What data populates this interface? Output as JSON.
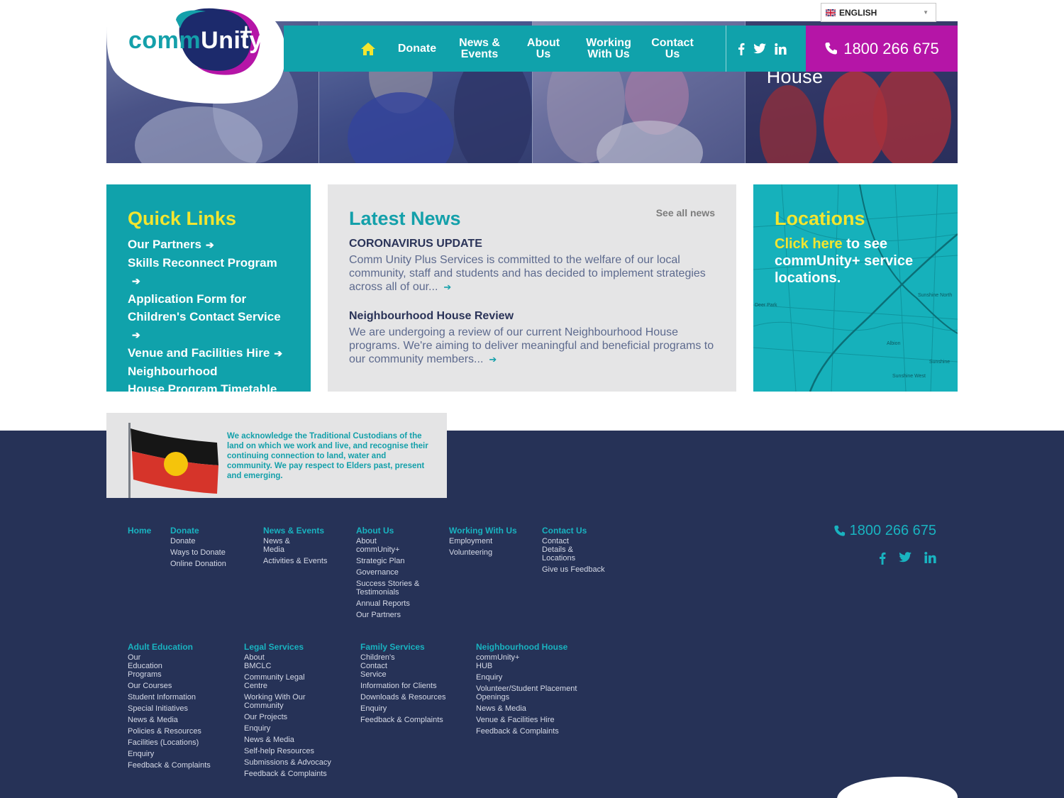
{
  "hero": {
    "caption": "House"
  },
  "logo": {
    "part1": "comm",
    "part2": "Unity",
    "plus": "+"
  },
  "language": {
    "selected": "ENGLISH"
  },
  "nav": {
    "home_icon": "home-icon",
    "donate": "Donate",
    "news_line1": "News &",
    "news_line2": "Events",
    "about_line1": "About",
    "about_line2": "Us",
    "work_line1": "Working",
    "work_line2": "With Us",
    "contact_line1": "Contact",
    "contact_line2": "Us",
    "social": [
      "facebook-icon",
      "twitter-icon",
      "linkedin-icon"
    ],
    "phone": "1800 266 675"
  },
  "quick_links": {
    "title": "Quick Links",
    "items": [
      {
        "label": "Our Partners"
      },
      {
        "label": "Skills Reconnect Program"
      },
      {
        "label": "Application Form for"
      },
      {
        "label": "Children's Contact Service"
      },
      {
        "label": "Venue and Facilities Hire"
      },
      {
        "label": "Neighbourhood"
      },
      {
        "label": "House Program Timetable"
      }
    ]
  },
  "latest_news": {
    "title": "Latest News",
    "see_all": "See all news",
    "items": [
      {
        "heading": "CORONAVIRUS UPDATE",
        "body": "Comm Unity Plus Services is committed to the welfare of our local community, staff and students and has decided to implement strategies across all of our..."
      },
      {
        "heading": "Neighbourhood House Review",
        "body": "We are undergoing a review of our current Neighbourhood House programs. We're aiming to deliver meaningful and beneficial programs to our community members..."
      }
    ]
  },
  "locations": {
    "title": "Locations",
    "link": "Click here",
    "text": " to see commUnity+ service locations.",
    "map_labels": [
      "Sunshine North",
      "Albion",
      "Sunshine",
      "Sunshine West",
      "Deer Park"
    ]
  },
  "acknowledgement": {
    "text": "We acknowledge the Traditional Custodians of the land on which we work and live, and recognise their continuing connection to land, water and community. We pay respect to Elders past, present and emerging."
  },
  "footer": {
    "phone": "1800 266 675",
    "row1": [
      {
        "head": "Home",
        "links": []
      },
      {
        "head": "Donate",
        "links": [
          "Donate",
          "Ways to Donate",
          "Online Donation"
        ]
      },
      {
        "head": "News & Events",
        "links": [
          "News & Media",
          "Activities & Events"
        ]
      },
      {
        "head": "About Us",
        "links": [
          "About commUnity+",
          "Strategic Plan",
          "Governance",
          "Success Stories & Testimonials",
          "Annual Reports",
          "Our Partners"
        ]
      },
      {
        "head": "Working With Us",
        "links": [
          "Employment",
          "Volunteering"
        ]
      },
      {
        "head": "Contact Us",
        "links": [
          "Contact Details & Locations",
          "Give us Feedback"
        ]
      }
    ],
    "row2": [
      {
        "head": "Adult Education",
        "links": [
          "Our Education Programs",
          "Our Courses",
          "Student Information",
          "Special Initiatives",
          "News & Media",
          "Policies & Resources",
          "Facilities (Locations)",
          "Enquiry",
          "Feedback & Complaints"
        ]
      },
      {
        "head": "Legal Services",
        "links": [
          "About BMCLC",
          "Community Legal Centre",
          "Working With Our Community",
          "Our Projects",
          "Enquiry",
          "News & Media",
          "Self-help Resources",
          "Submissions & Advocacy",
          "Feedback & Complaints"
        ]
      },
      {
        "head": "Family Services",
        "links": [
          "Children's Contact Service",
          "Information for Clients",
          "Downloads & Resources",
          "Enquiry",
          "Feedback & Complaints"
        ]
      },
      {
        "head": "Neighbourhood House",
        "links": [
          "commUnity+ HUB",
          "Enquiry",
          "Volunteer/Student Placement Openings",
          "News & Media",
          "Venue & Facilities Hire",
          "Feedback & Complaints"
        ]
      }
    ]
  },
  "colors": {
    "teal": "#10a2ab",
    "magenta": "#b515a7",
    "navy": "#263257",
    "yellow": "#f3e52f"
  }
}
